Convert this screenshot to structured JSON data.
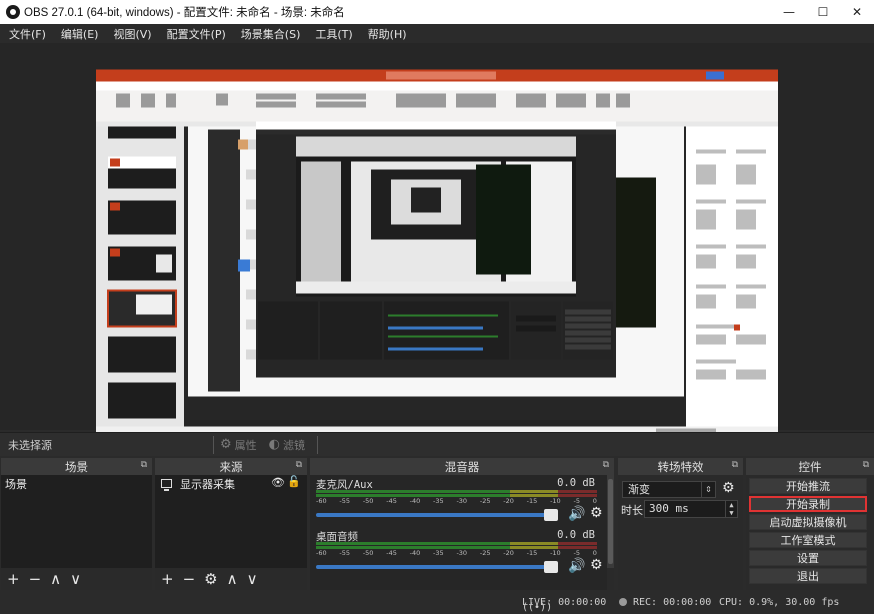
{
  "window": {
    "title": "OBS 27.0.1 (64-bit, windows) - 配置文件: 未命名 - 场景: 未命名"
  },
  "menu": [
    "文件(F)",
    "编辑(E)",
    "视图(V)",
    "配置文件(P)",
    "场景集合(S)",
    "工具(T)",
    "帮助(H)"
  ],
  "context": {
    "no_source": "未选择源",
    "properties": "属性",
    "filters": "滤镜"
  },
  "scenes": {
    "title": "场景",
    "items": [
      "场景"
    ]
  },
  "sources": {
    "title": "来源",
    "items": [
      "显示器采集"
    ]
  },
  "mixer": {
    "title": "混音器",
    "channels": [
      {
        "name": "麦克风/Aux",
        "db": "0.0 dB"
      },
      {
        "name": "桌面音频",
        "db": "0.0 dB"
      }
    ],
    "ticks": [
      "-60",
      "-55",
      "-50",
      "-45",
      "-40",
      "-35",
      "-30",
      "-25",
      "-20",
      "-15",
      "-10",
      "-5",
      "0"
    ]
  },
  "transitions": {
    "title": "转场特效",
    "selected": "渐变",
    "duration_label": "时长",
    "duration_value": "300 ms"
  },
  "controls": {
    "title": "控件",
    "start_stream": "开始推流",
    "start_record": "开始录制",
    "virtual_cam": "启动虚拟摄像机",
    "studio_mode": "工作室模式",
    "settings": "设置",
    "exit": "退出"
  },
  "status": {
    "live": "LIVE: 00:00:00",
    "rec": "REC: 00:00:00",
    "cpu": "CPU: 0.9%, 30.00 fps"
  },
  "colors": {
    "accent": "#3a78c4",
    "record_highlight": "#e03333",
    "ppt_red": "#c43e1c"
  }
}
